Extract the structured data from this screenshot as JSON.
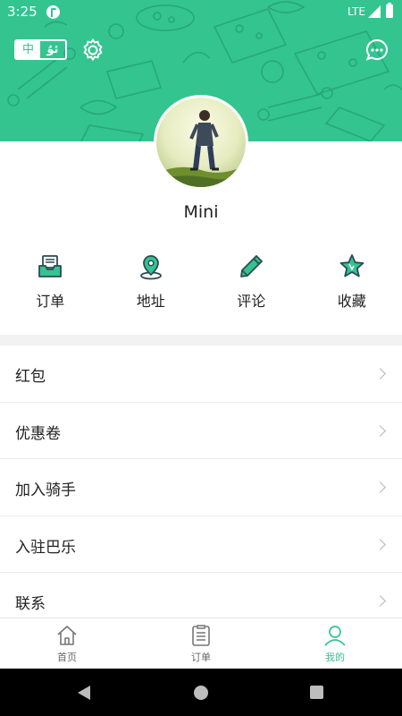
{
  "status_bar": {
    "time": "3:25",
    "network": "LTE"
  },
  "header": {
    "lang_zh": "中",
    "lang_ug": "ئۇ",
    "settings_icon": "gear-icon",
    "chat_icon": "chat-bubble-icon",
    "accent_color": "#33c48f"
  },
  "profile": {
    "username": "Mini"
  },
  "quick_actions": [
    {
      "label": "订单",
      "icon": "order-tray-icon"
    },
    {
      "label": "地址",
      "icon": "location-pin-icon"
    },
    {
      "label": "评论",
      "icon": "pencil-icon"
    },
    {
      "label": "收藏",
      "icon": "star-icon"
    }
  ],
  "menu": [
    {
      "label": "红包"
    },
    {
      "label": "优惠卷"
    },
    {
      "label": "加入骑手"
    },
    {
      "label": "入驻巴乐"
    },
    {
      "label": "联系"
    }
  ],
  "tabbar": [
    {
      "label": "首页",
      "icon": "home-icon",
      "active": false
    },
    {
      "label": "订单",
      "icon": "clipboard-icon",
      "active": false
    },
    {
      "label": "我的",
      "icon": "user-icon",
      "active": true
    }
  ]
}
